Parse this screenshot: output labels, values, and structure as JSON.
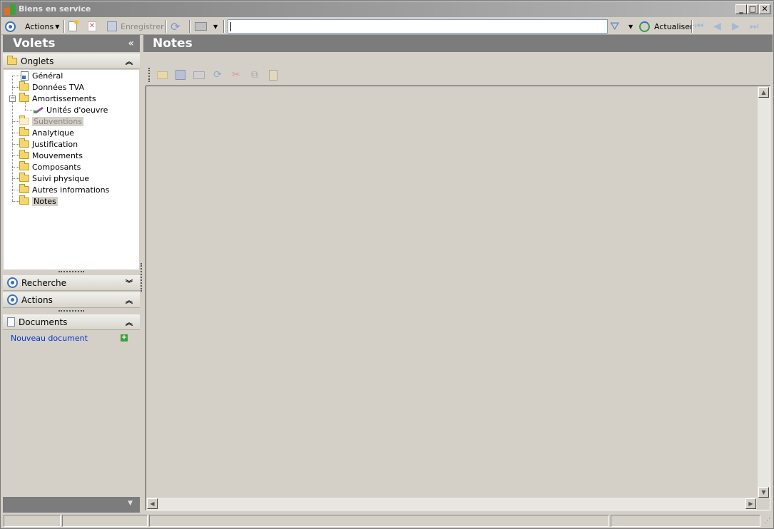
{
  "window": {
    "title": "Biens en service",
    "controls": [
      "_",
      "□",
      "✕"
    ]
  },
  "toolbar": {
    "actions_label": "Actions",
    "save_label": "Enregistrer",
    "search_value": "",
    "refresh_label": "Actualiser"
  },
  "left_pane": {
    "title": "Volets",
    "collapse_glyph": "«",
    "tabs_group": {
      "label": "Onglets",
      "items": [
        {
          "label": "Général",
          "icon": "document-icon"
        },
        {
          "label": "Données TVA",
          "icon": "folder-icon"
        },
        {
          "label": "Amortissements",
          "icon": "folder-icon",
          "expanded": true
        },
        {
          "label": "Unités d'oeuvre",
          "icon": "pencil-icon",
          "indent": 1
        },
        {
          "label": "Subventions",
          "icon": "folder-icon",
          "disabled": true
        },
        {
          "label": "Analytique",
          "icon": "folder-icon"
        },
        {
          "label": "Justification",
          "icon": "folder-icon"
        },
        {
          "label": "Mouvements",
          "icon": "folder-icon"
        },
        {
          "label": "Composants",
          "icon": "folder-icon"
        },
        {
          "label": "Suivi physique",
          "icon": "folder-icon"
        },
        {
          "label": "Autres informations",
          "icon": "folder-icon"
        },
        {
          "label": "Notes",
          "icon": "open-folder-icon",
          "selected": true
        }
      ]
    },
    "search_group": {
      "label": "Recherche"
    },
    "actions_group": {
      "label": "Actions"
    },
    "documents_group": {
      "label": "Documents",
      "new_document": "Nouveau document"
    }
  },
  "main": {
    "title": "Notes"
  },
  "colors": {
    "header_bg": "#7c7c7c",
    "link": "#0033cc",
    "accent": "#3b6fc2"
  }
}
